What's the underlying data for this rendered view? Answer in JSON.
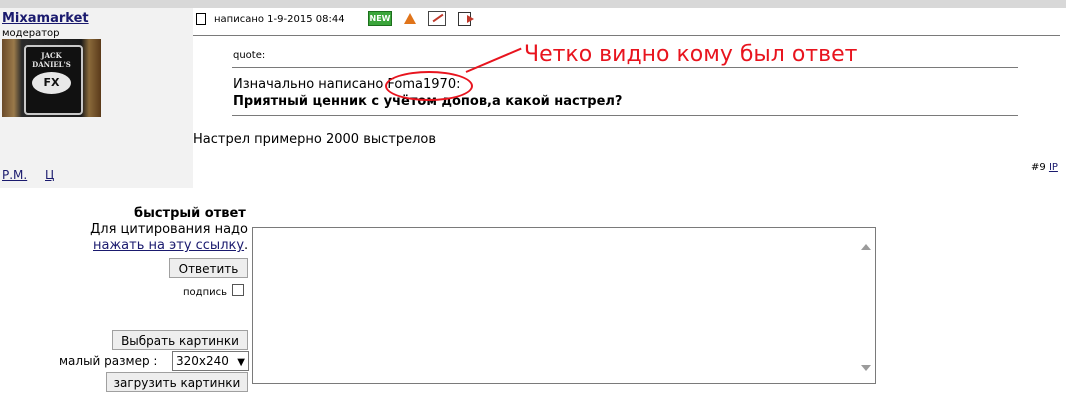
{
  "post": {
    "author": "Mixamarket",
    "role": "модератор",
    "avatar_text": "JACK DANIEL'S",
    "avatar_badge": "FX",
    "meta": "написано 1-9-2015 08:44",
    "icons": [
      "edit-icon",
      "warning-icon",
      "pencil-icon",
      "exit-icon"
    ],
    "edit_icon_label": "NEW",
    "quote_label": "quote:",
    "quote_original": "Изначально написано Foma1970:",
    "quote_text": "Приятный ценник с учётом допов,а какой настрел?",
    "reply_text": "Настрел примерно 2000 выстрелов",
    "annotation": "Четко видно кому был ответ",
    "pm_link": "Р.М.",
    "c_link": "Ц",
    "post_number": "#9",
    "ip_link": "IP"
  },
  "quick_reply": {
    "title": "быстрый ответ",
    "hint": "Для цитирования надо",
    "link": "нажать на эту ссылку",
    "link_suffix": ".",
    "reply_button": "Ответить",
    "signature_label": "подпись",
    "choose_images_button": "Выбрать картинки",
    "size_label": "малый размер :",
    "size_value": "320x240",
    "upload_button": "загрузить картинки"
  },
  "colors": {
    "annotation": "#e8141e",
    "link": "#1a1a6e",
    "post_bg": "#f2f2f2"
  }
}
